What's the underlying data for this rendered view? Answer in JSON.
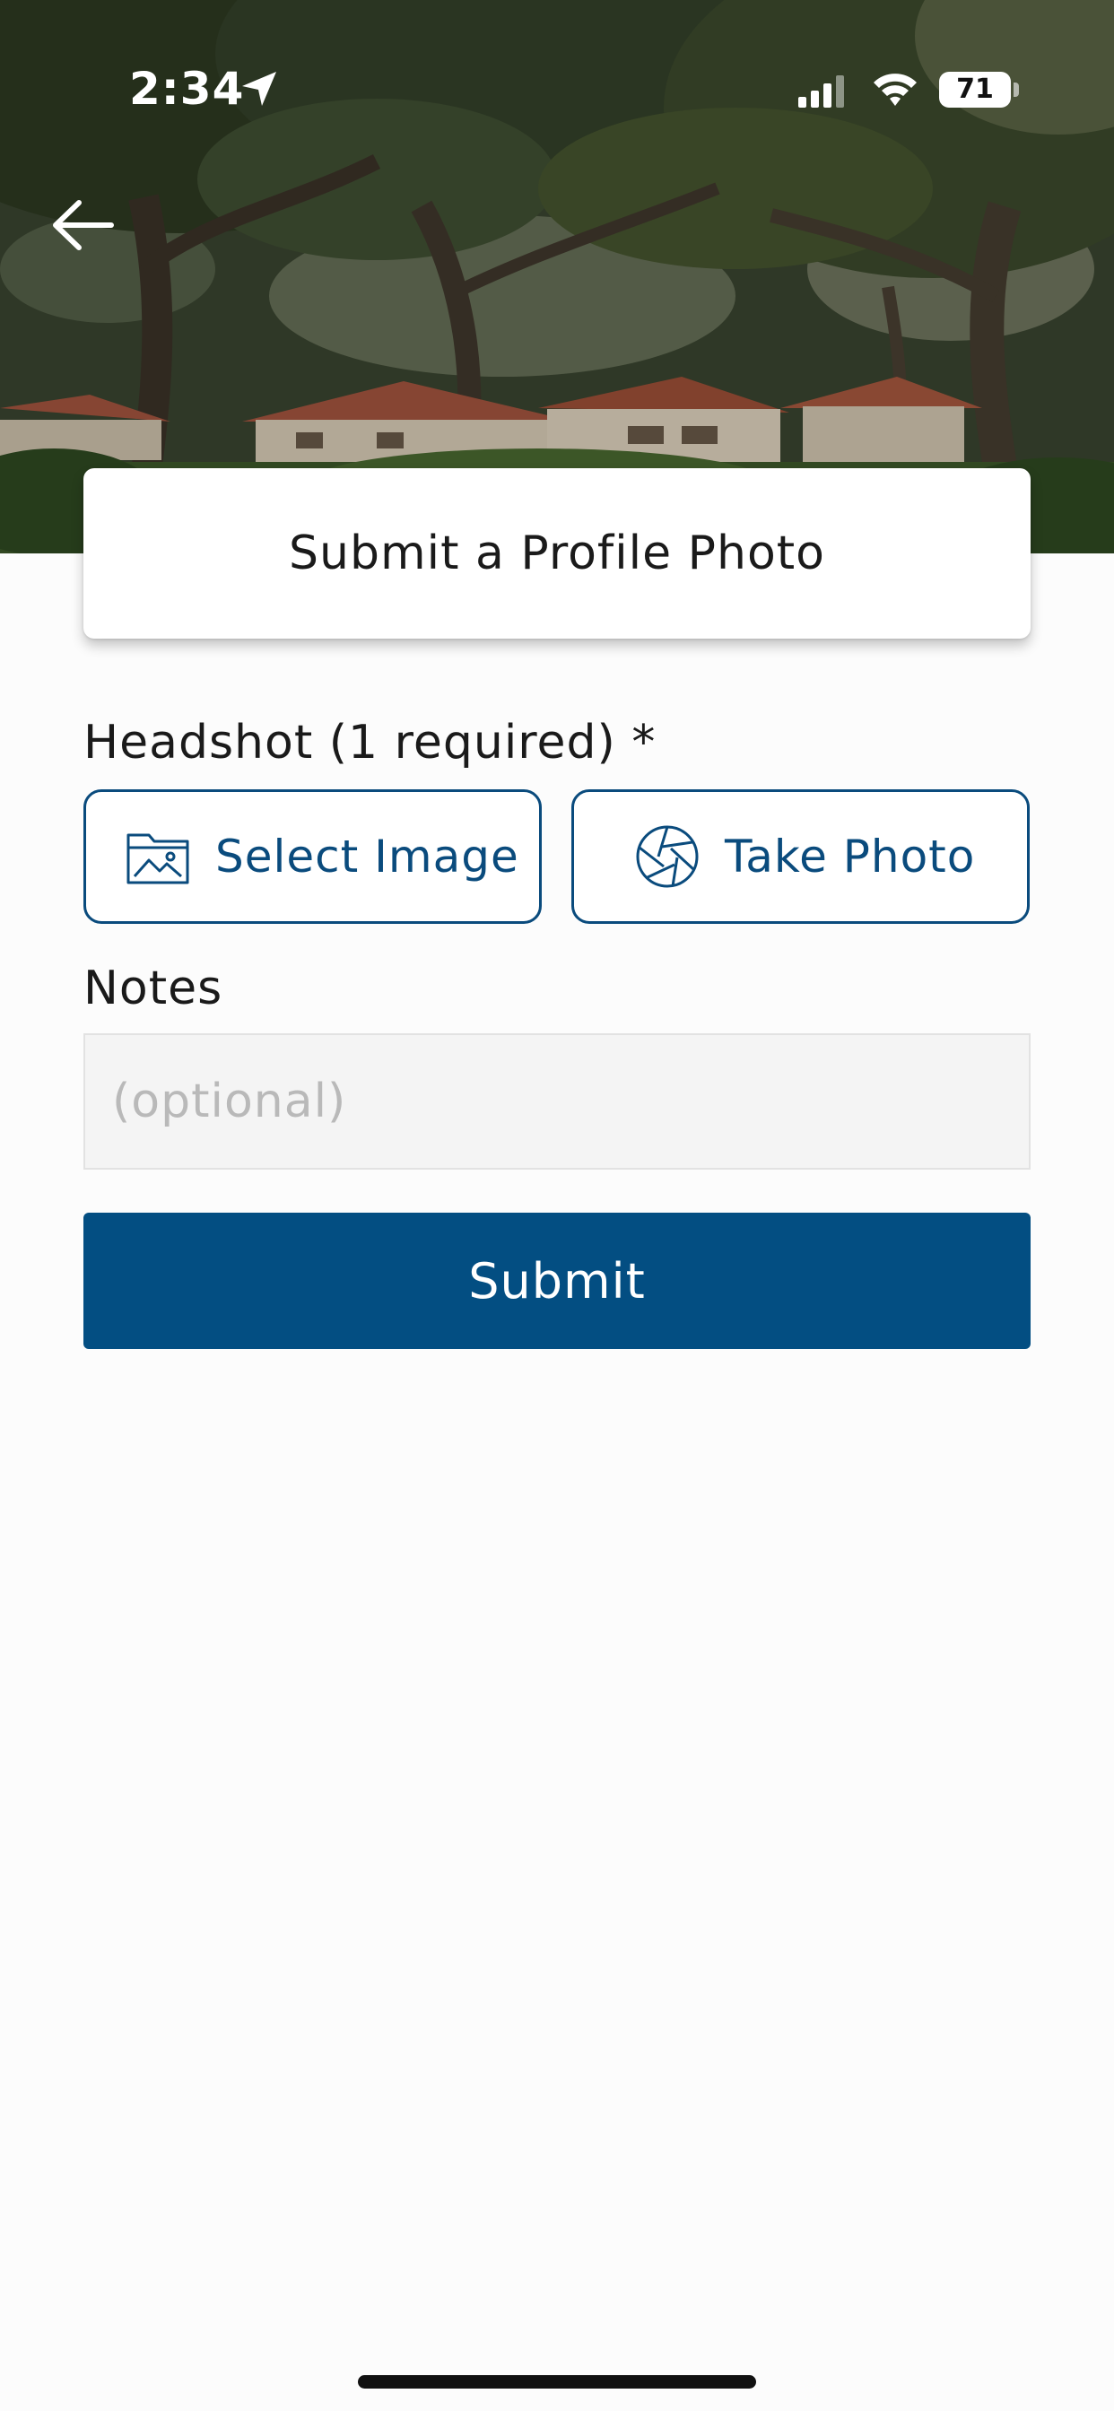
{
  "status_bar": {
    "time": "2:34",
    "battery_level": "71",
    "icons": [
      "location-arrow-icon",
      "cellular-signal-icon",
      "wifi-icon",
      "battery-icon"
    ]
  },
  "header": {
    "back_icon": "arrow-left-icon",
    "title": "Submit a Profile Photo"
  },
  "form": {
    "headshot_label": "Headshot (1 required) *",
    "select_image": {
      "label": "Select Image",
      "icon": "image-folder-icon"
    },
    "take_photo": {
      "label": "Take Photo",
      "icon": "camera-aperture-icon"
    },
    "notes_label": "Notes",
    "notes_value": "",
    "notes_placeholder": "(optional)",
    "submit_label": "Submit"
  },
  "colors": {
    "accent": "#0a4b7d",
    "submit_bg": "#034e82",
    "background": "#fcfcfc",
    "input_bg": "#f4f4f4"
  }
}
